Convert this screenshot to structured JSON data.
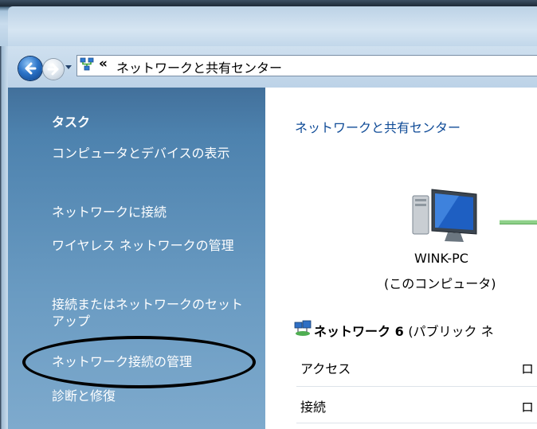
{
  "address_bar": {
    "chevron": "«",
    "path": "ネットワークと共有センター"
  },
  "sidebar": {
    "heading": "タスク",
    "items": [
      {
        "label": "コンピュータとデバイスの表示"
      },
      {
        "label": "ネットワークに接続"
      },
      {
        "label": "ワイヤレス ネットワークの管理"
      },
      {
        "label": "接続またはネットワークのセットアップ"
      },
      {
        "label": "ネットワーク接続の管理"
      },
      {
        "label": "診断と修復"
      }
    ]
  },
  "main": {
    "title": "ネットワークと共有センター",
    "computer_name": "WINK-PC",
    "computer_sub": "(このコンピュータ)",
    "network": {
      "name": "ネットワーク",
      "number": "6",
      "type": "(パブリック ネ"
    },
    "rows": [
      {
        "label": "アクセス",
        "value": "ロ"
      },
      {
        "label": "接続",
        "value": "ロ"
      }
    ]
  },
  "colors": {
    "sidebar_top": "#42709b",
    "sidebar_bottom": "#7eaacd",
    "link_blue": "#0f4b97",
    "annotation": "#000000"
  },
  "icons": [
    "back-arrow-icon",
    "forward-arrow-icon",
    "network-center-icon",
    "computer-icon",
    "network-icon"
  ]
}
